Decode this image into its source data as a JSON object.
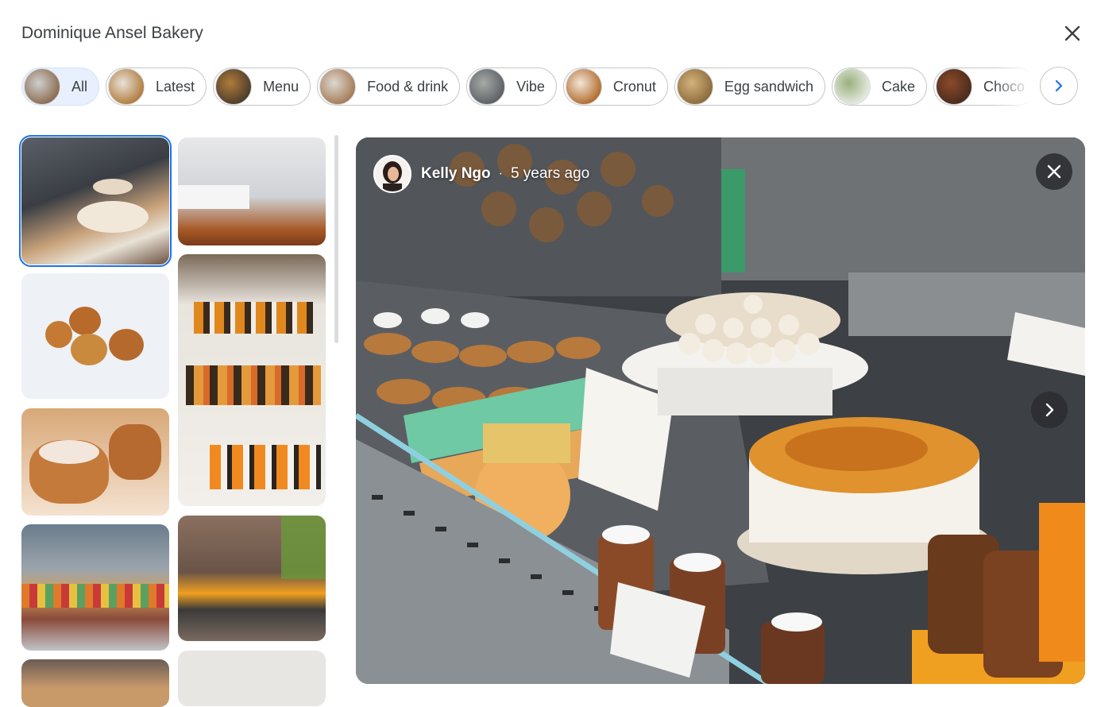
{
  "header": {
    "title": "Dominique Ansel Bakery",
    "close_icon": "close-icon"
  },
  "chips": [
    {
      "label": "All",
      "active": true,
      "thumb_colors": [
        "#8a6a4e",
        "#cfcfcf"
      ]
    },
    {
      "label": "Latest",
      "active": false,
      "thumb_colors": [
        "#b07a3a",
        "#e8e2d8"
      ]
    },
    {
      "label": "Menu",
      "active": false,
      "thumb_colors": [
        "#4a3b2c",
        "#b07c3a"
      ]
    },
    {
      "label": "Food & drink",
      "active": false,
      "thumb_colors": [
        "#a47a55",
        "#ddd8d0"
      ]
    },
    {
      "label": "Vibe",
      "active": false,
      "thumb_colors": [
        "#5b5f63",
        "#a8aaa8"
      ]
    },
    {
      "label": "Cronut",
      "active": false,
      "thumb_colors": [
        "#b06a2a",
        "#f3e6d8"
      ]
    },
    {
      "label": "Egg sandwich",
      "active": false,
      "thumb_colors": [
        "#8a6a3a",
        "#d4b27c"
      ]
    },
    {
      "label": "Cake",
      "active": false,
      "thumb_colors": [
        "#e8ece4",
        "#9ab07c"
      ]
    },
    {
      "label": "Choco",
      "active": false,
      "thumb_colors": [
        "#4a2a1c",
        "#8a4a2a"
      ]
    }
  ],
  "chip_next_icon": "chevron-right-icon",
  "viewer": {
    "author": "Kelly Ngo",
    "separator": "·",
    "age": "5 years ago",
    "close_icon": "close-icon",
    "next_icon": "chevron-right-icon"
  },
  "colors": {
    "accent": "#1a73e8",
    "active_chip_bg": "#e8f0fe"
  }
}
